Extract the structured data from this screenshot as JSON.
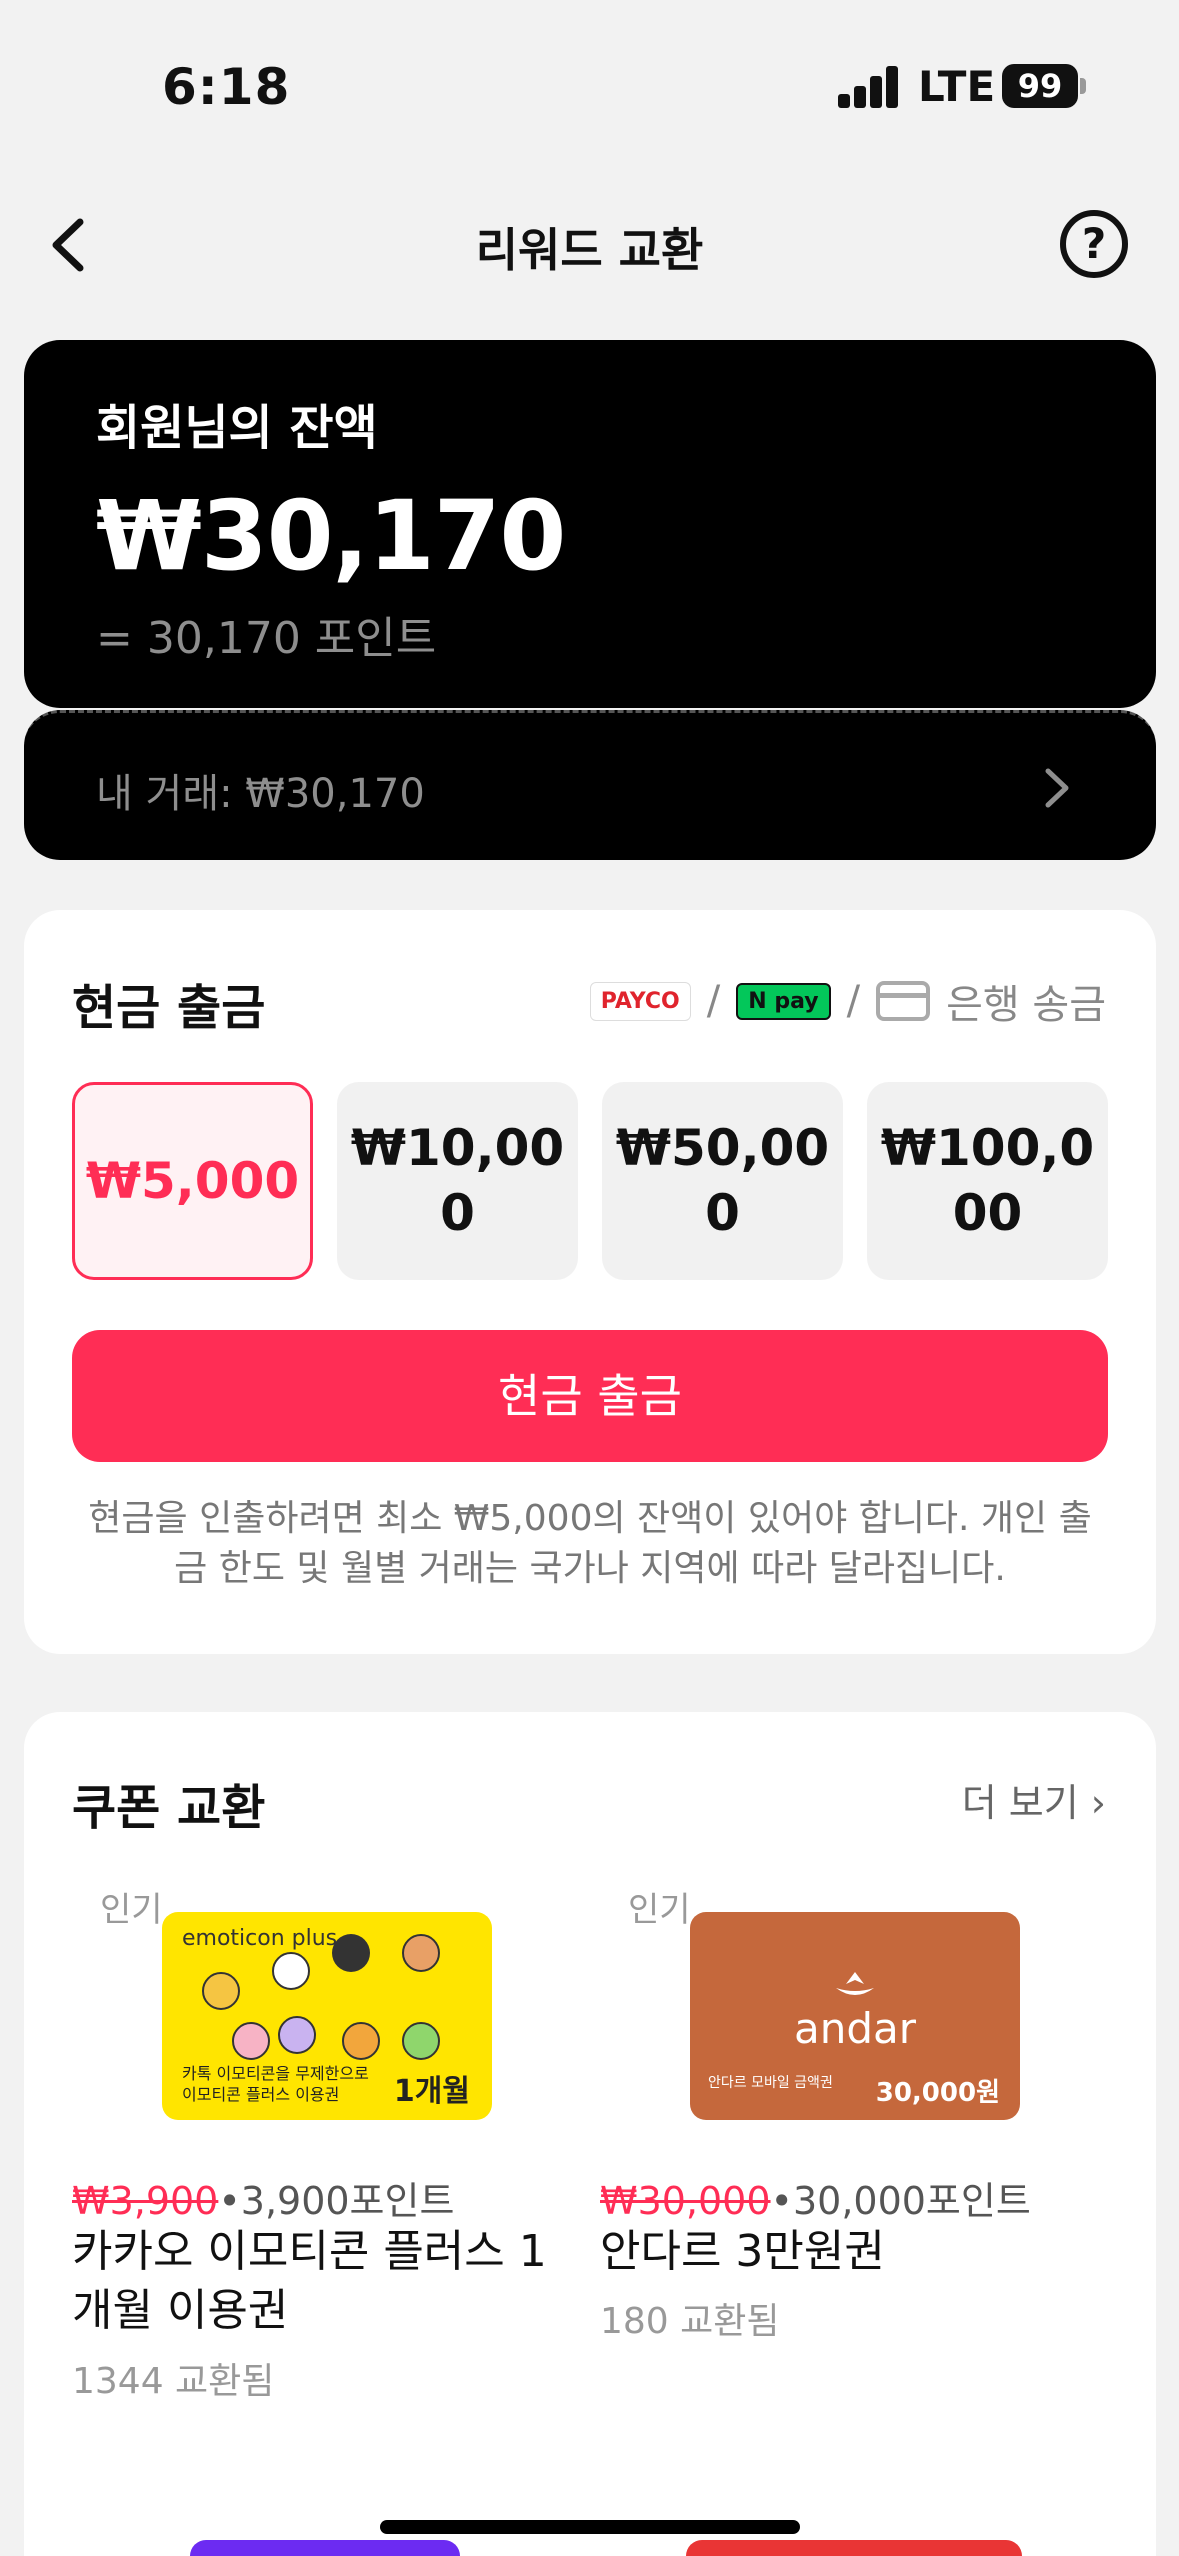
{
  "status_bar": {
    "time": "6:18",
    "network": "LTE",
    "battery": "99"
  },
  "nav": {
    "title": "리워드 교환",
    "back_icon": "chevron-left-icon",
    "help_label": "?"
  },
  "balance": {
    "label": "회원님의 잔액",
    "amount": "₩30,170",
    "points": "= 30,170 포인트",
    "transactions": "내 거래: ₩30,170"
  },
  "withdraw": {
    "title": "현금 출금",
    "methods": {
      "payco": "PAYCO",
      "npay": "N pay",
      "separator": "/",
      "bank": "은행 송금"
    },
    "amounts": [
      {
        "label": "₩5,000",
        "selected": true
      },
      {
        "label": "₩10,000",
        "selected": false
      },
      {
        "label": "₩50,000",
        "selected": false
      },
      {
        "label": "₩100,000",
        "selected": false
      }
    ],
    "button": "현금 출금",
    "note": "현금을 인출하려면 최소 ₩5,000의 잔액이 있어야 합니다. 개인 출금 한도 및 월별 거래는 국가나 지역에 따라 달라집니다."
  },
  "coupons": {
    "title": "쿠폰 교환",
    "more": "더 보기 ›",
    "items": [
      {
        "badge": "인기",
        "image_brand": "emoticon plus",
        "image_caption": "카톡 이모티콘을 무제한으로 이모티콘 플러스 이용권",
        "image_tag": "1개월",
        "original_price": "₩3,900",
        "price_points": "•3,900포인트",
        "name": "카카오 이모티콘 플러스 1개월 이용권",
        "count": "1344 교환됨"
      },
      {
        "badge": "인기",
        "image_brand": "andar",
        "image_caption": "안다르 모바일 금액권",
        "image_tag": "30,000원",
        "original_price": "₩30,000",
        "price_points": "•30,000포인트",
        "name": "안다르 3만원권",
        "count": "180 교환됨"
      }
    ]
  },
  "colors": {
    "accent": "#ff2d55",
    "card_dark": "#000000",
    "background": "#f2f2f2"
  }
}
